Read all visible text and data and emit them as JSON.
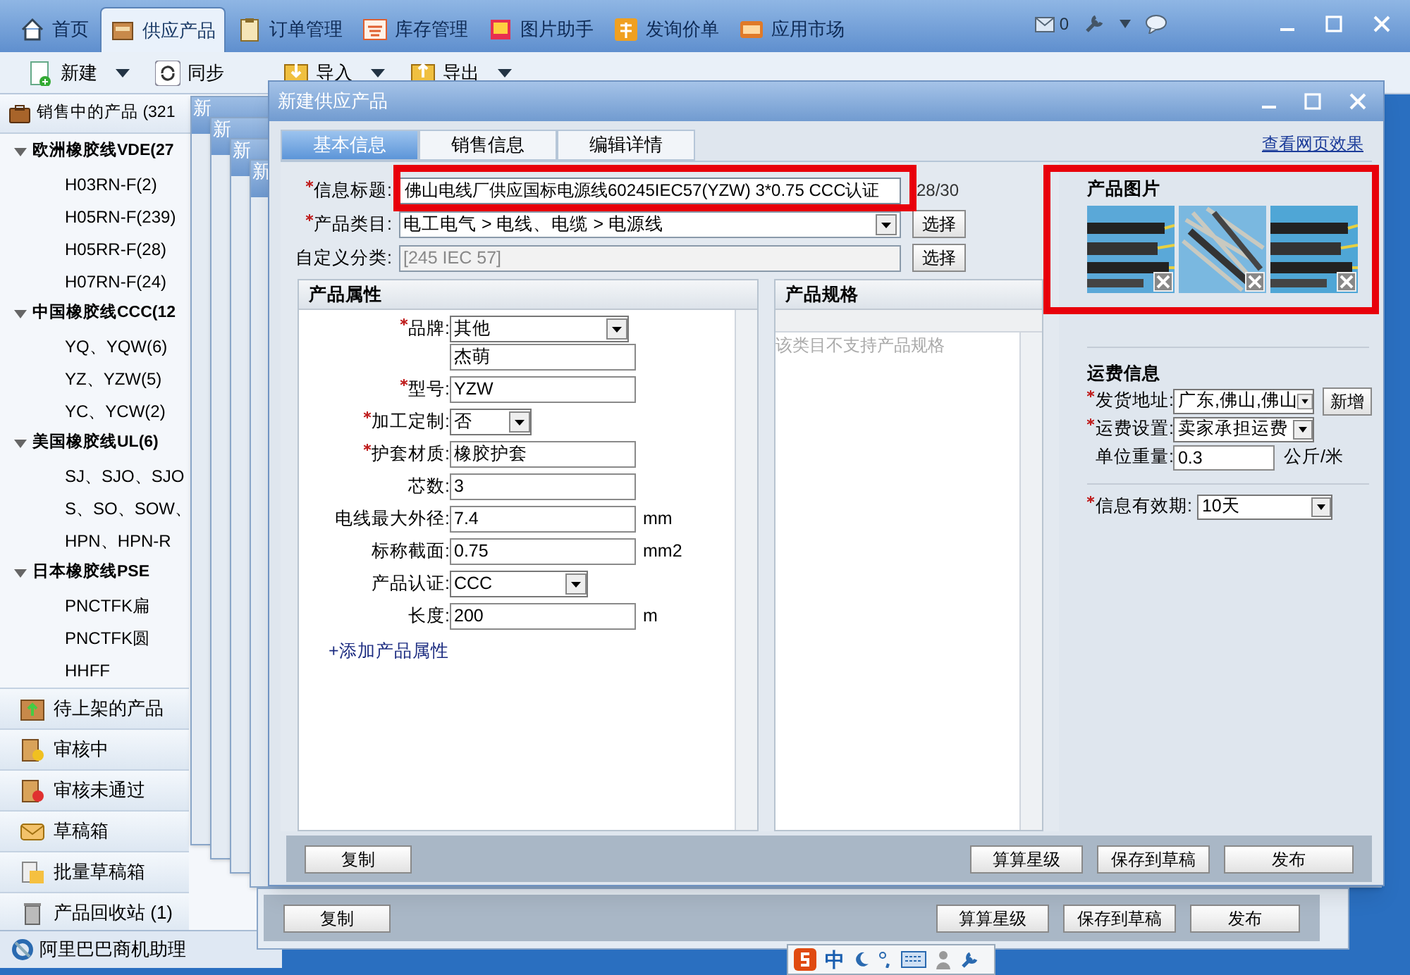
{
  "app_tabs": [
    {
      "label": "首页",
      "selected": false
    },
    {
      "label": "供应产品",
      "selected": true
    },
    {
      "label": "订单管理",
      "selected": false
    },
    {
      "label": "库存管理",
      "selected": false
    },
    {
      "label": "图片助手",
      "selected": false
    },
    {
      "label": "发询价单",
      "selected": false
    },
    {
      "label": "应用市场",
      "selected": false
    }
  ],
  "mail_count": "0",
  "toolbar": [
    {
      "label": "新建",
      "dropdown": true
    },
    {
      "label": "同步",
      "dropdown": false
    },
    {
      "label": "导入",
      "dropdown": true
    },
    {
      "label": "导出",
      "dropdown": true
    }
  ],
  "sidebar": {
    "header": "销售中的产品 (321",
    "groups": [
      {
        "label": "欧洲橡胶线VDE(27",
        "expanded": true,
        "children": [
          {
            "label": "H03RN-F(2)"
          },
          {
            "label": "H05RN-F(239)"
          },
          {
            "label": "H05RR-F(28)"
          },
          {
            "label": "H07RN-F(24)"
          }
        ]
      },
      {
        "label": "中国橡胶线CCC(12",
        "expanded": true,
        "children": [
          {
            "label": "YQ、YQW(6)"
          },
          {
            "label": "YZ、YZW(5)"
          },
          {
            "label": "YC、YCW(2)"
          }
        ]
      },
      {
        "label": "美国橡胶线UL(6)",
        "expanded": true,
        "children": [
          {
            "label": "SJ、SJO、SJO"
          },
          {
            "label": "S、SO、SOW、"
          },
          {
            "label": "HPN、HPN-R"
          }
        ]
      },
      {
        "label": "日本橡胶线PSE",
        "expanded": true,
        "children": [
          {
            "label": "PNCTFK扁"
          },
          {
            "label": "PNCTFK圆"
          },
          {
            "label": "HHFF"
          }
        ]
      }
    ],
    "sections": [
      {
        "label": "待上架的产品",
        "kind": "upload"
      },
      {
        "label": "审核中",
        "kind": "pending"
      },
      {
        "label": "审核未通过",
        "kind": "rejected"
      },
      {
        "label": "草稿箱",
        "kind": "draft"
      },
      {
        "label": "批量草稿箱",
        "kind": "batch"
      },
      {
        "label": "产品回收站 (1)",
        "kind": "trash"
      }
    ],
    "footer": "阿里巴巴商机助理"
  },
  "stacked_windows": [
    {
      "title": "新"
    },
    {
      "title": "新"
    },
    {
      "title": "新"
    },
    {
      "title": "新"
    }
  ],
  "back_dialog": {
    "buttons": [
      "复制",
      "算算星级",
      "保存到草稿",
      "发布"
    ]
  },
  "dialog": {
    "title": "新建供应产品",
    "tabs": [
      {
        "label": "基本信息",
        "selected": true
      },
      {
        "label": "销售信息",
        "selected": false
      },
      {
        "label": "编辑详情",
        "selected": false
      }
    ],
    "preview_link": "查看网页效果",
    "title_field": {
      "label": "信息标题:",
      "required": true,
      "value": "佛山电线厂供应国标电源线60245IEC57(YZW) 3*0.75  CCC认证",
      "count": "28/30"
    },
    "category_field": {
      "label": "产品类目:",
      "required": true,
      "value": "电工电气 > 电线、电缆 > 电源线",
      "button": "选择"
    },
    "custom_field": {
      "label": "自定义分类:",
      "required": false,
      "disabled": true,
      "value": "[245 IEC 57]",
      "button": "选择"
    },
    "attributes": {
      "title": "产品属性",
      "add_link": "+添加产品属性",
      "rows": [
        {
          "label": "品牌:",
          "required": true,
          "kind": "select",
          "value": "其他",
          "extra_value": "杰萌"
        },
        {
          "label": "型号:",
          "required": true,
          "kind": "text",
          "value": "YZW"
        },
        {
          "label": "加工定制:",
          "required": true,
          "kind": "select",
          "value": "否"
        },
        {
          "label": "护套材质:",
          "required": true,
          "kind": "text",
          "value": "橡胶护套"
        },
        {
          "label": "芯数:",
          "required": false,
          "kind": "text",
          "value": "3"
        },
        {
          "label": "电线最大外径:",
          "required": false,
          "kind": "text",
          "value": "7.4",
          "unit": "mm"
        },
        {
          "label": "标称截面:",
          "required": false,
          "kind": "text",
          "value": "0.75",
          "unit": "mm2"
        },
        {
          "label": "产品认证:",
          "required": false,
          "kind": "select",
          "value": "CCC"
        },
        {
          "label": "长度:",
          "required": false,
          "kind": "text",
          "value": "200",
          "unit": "m"
        }
      ]
    },
    "specs": {
      "title": "产品规格",
      "note": "该类目不支持产品规格"
    },
    "pictures": {
      "title": "产品图片"
    },
    "shipping": {
      "title": "运费信息",
      "address": {
        "label": "发货地址:",
        "required": true,
        "value": "广东,佛山,佛山",
        "button": "新增"
      },
      "fee": {
        "label": "运费设置:",
        "required": true,
        "value": "卖家承担运费"
      },
      "weight": {
        "label": "单位重量:",
        "required": false,
        "value": "0.3",
        "unit": "公斤/米"
      }
    },
    "validity": {
      "label": "信息有效期:",
      "required": true,
      "value": "10天"
    },
    "buttons": [
      "复制",
      "算算星级",
      "保存到草稿",
      "发布"
    ]
  },
  "ime": {
    "label": "中"
  }
}
